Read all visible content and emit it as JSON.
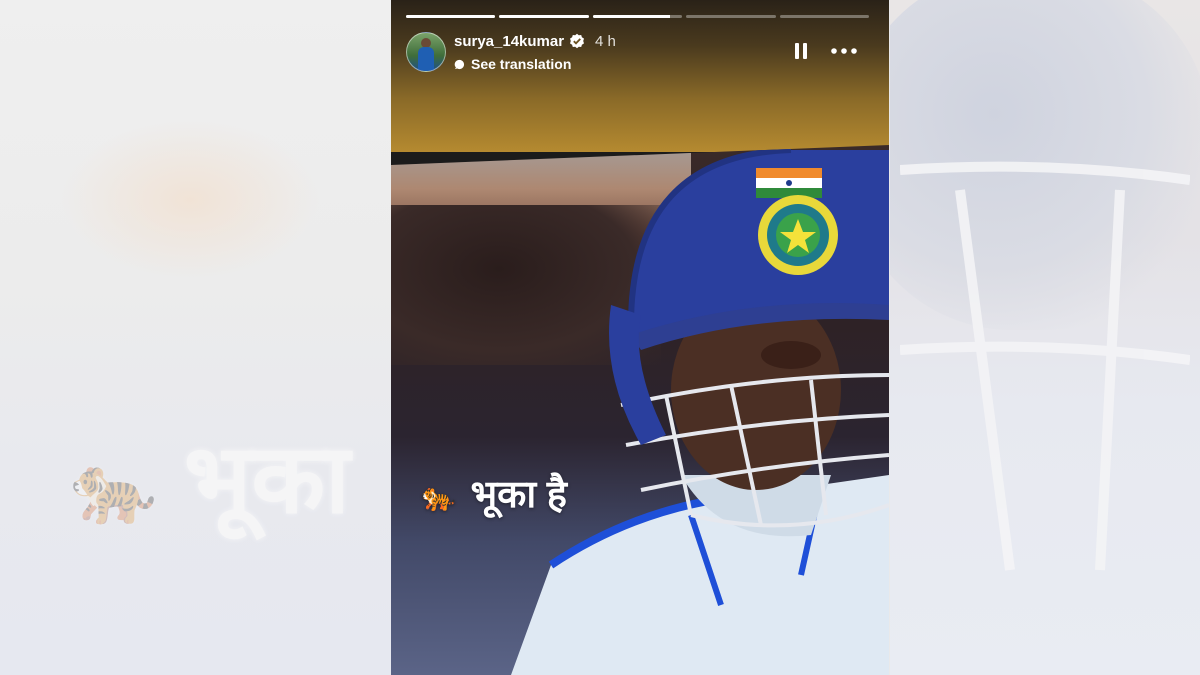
{
  "story": {
    "progress": [
      1,
      1,
      0.86,
      0,
      0
    ],
    "username": "surya_14kumar",
    "time": "4 h",
    "translate_label": "See translation",
    "caption_text": "भूका है",
    "caption_emoji": "🐅"
  },
  "background": {
    "caption_text": "भूका",
    "caption_emoji": "🐅"
  },
  "icons": {
    "verified": "verified-badge-icon",
    "translate": "translate-icon",
    "pause": "pause-icon",
    "more": "more-icon"
  },
  "colors": {
    "helmet": "#2a3f9e",
    "jersey": "#dfe9f3",
    "accent_blue": "#1e4fd8"
  }
}
